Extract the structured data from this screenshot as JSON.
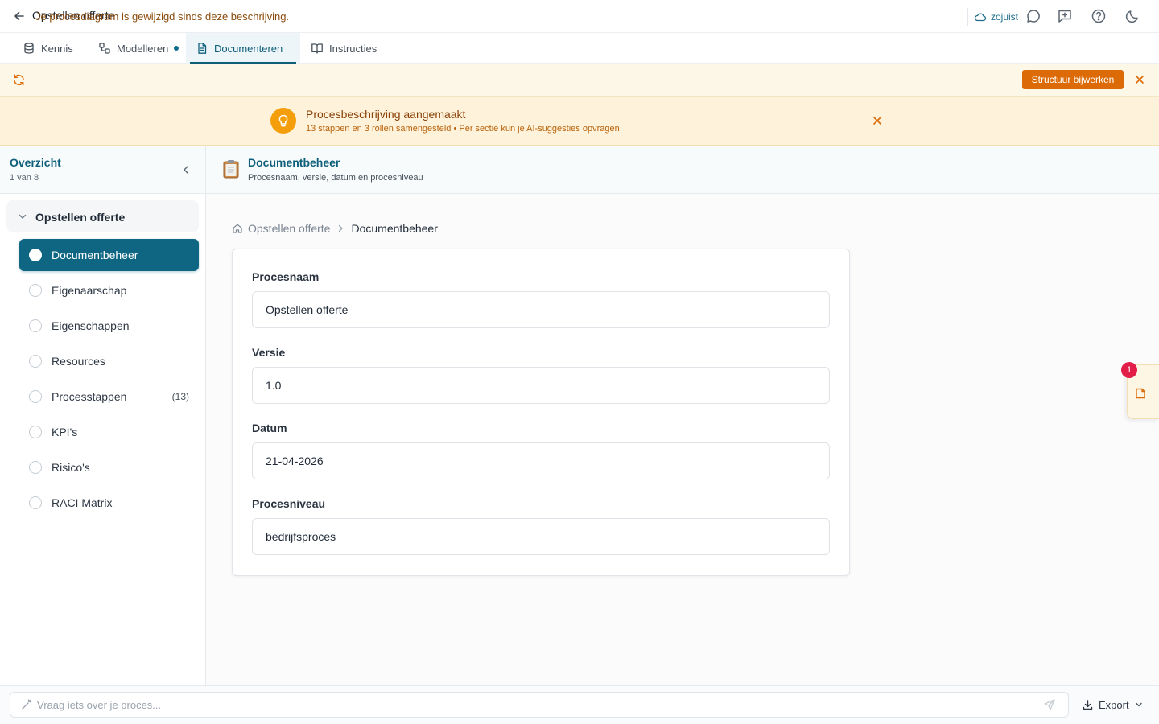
{
  "header": {
    "title": "Opstellen offerte",
    "save_status": "zojuist"
  },
  "tabs": [
    {
      "label": "Kennis"
    },
    {
      "label": "Modelleren"
    },
    {
      "label": "Documenteren"
    },
    {
      "label": "Instructies"
    }
  ],
  "change_banner": {
    "text": "Je procesdiagram is gewijzigd sinds deze beschrijving.",
    "button": "Structuur bijwerken"
  },
  "success_banner": {
    "title": "Procesbeschrijving aangemaakt",
    "subtitle": "13 stappen en 3 rollen samengesteld • Per sectie kun je AI-suggesties opvragen"
  },
  "sidebar": {
    "title": "Overzicht",
    "subtitle": "1 van 8",
    "group": "Opstellen offerte",
    "items": [
      {
        "label": "Documentbeheer",
        "count": ""
      },
      {
        "label": "Eigenaarschap",
        "count": ""
      },
      {
        "label": "Eigenschappen",
        "count": ""
      },
      {
        "label": "Resources",
        "count": ""
      },
      {
        "label": "Processtappen",
        "count": "(13)"
      },
      {
        "label": "KPI's",
        "count": ""
      },
      {
        "label": "Risico's",
        "count": ""
      },
      {
        "label": "RACI Matrix",
        "count": ""
      }
    ]
  },
  "content": {
    "title": "Documentbeheer",
    "subtitle": "Procesnaam, versie, datum en procesniveau",
    "breadcrumb": {
      "home": "Opstellen offerte",
      "current": "Documentbeheer"
    },
    "fields": [
      {
        "label": "Procesnaam",
        "value": "Opstellen offerte"
      },
      {
        "label": "Versie",
        "value": "1.0"
      },
      {
        "label": "Datum",
        "value": "21-04-2026"
      },
      {
        "label": "Procesniveau",
        "value": "bedrijfsproces"
      }
    ]
  },
  "float_widget": {
    "badge": "1"
  },
  "bottom": {
    "ask_placeholder": "Vraag iets over je proces...",
    "export_label": "Export"
  },
  "colors": {
    "primary": "#0e6683",
    "accent_orange": "#dc6a06",
    "badge_red": "#e11d48"
  },
  "icons": {
    "back": "arrow-left-icon",
    "cloud": "cloud-icon",
    "chat": "chat-bubble-icon",
    "feedback": "message-plus-icon",
    "help": "help-circle-icon",
    "theme": "moon-icon",
    "tab_kennis": "database-icon",
    "tab_modelleren": "diagram-icon",
    "tab_documenteren": "file-text-icon",
    "tab_instructies": "book-open-icon",
    "refresh": "refresh-icon",
    "bulb": "lightbulb-icon",
    "home": "home-icon",
    "export": "download-icon"
  }
}
